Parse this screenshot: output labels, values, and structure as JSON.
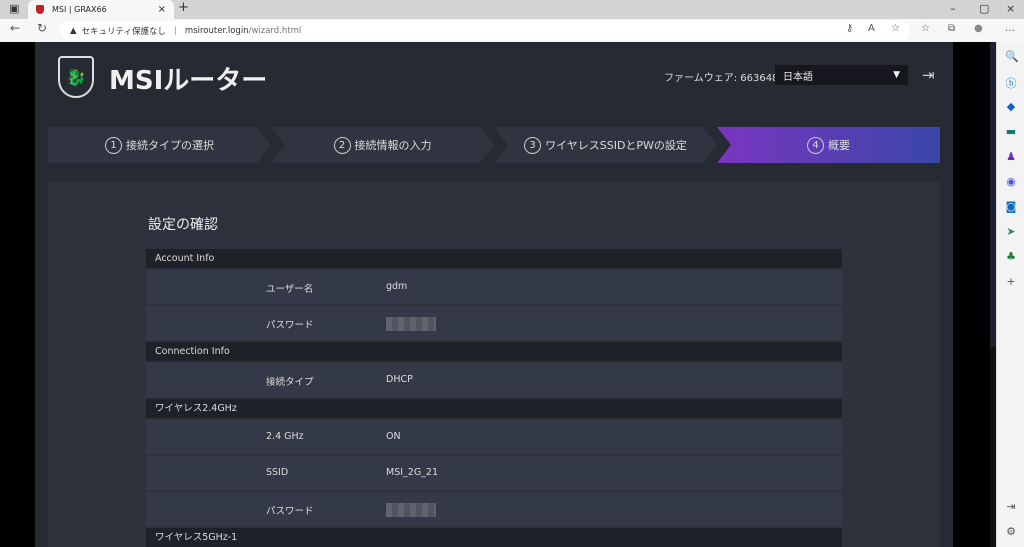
{
  "browser": {
    "tab_title": "MSI | GRAX66",
    "security_label": "セキュリティ保護なし",
    "url_host": "msirouter.login",
    "url_path": "/wizard.html"
  },
  "header": {
    "brand": "MSIルーター",
    "firmware_label": "ファームウェア: 663648",
    "language": "日本語"
  },
  "steps": [
    {
      "num": "1",
      "label": "接続タイプの選択"
    },
    {
      "num": "2",
      "label": "接続情報の入力"
    },
    {
      "num": "3",
      "label": "ワイヤレスSSIDとPWの設定"
    },
    {
      "num": "4",
      "label": "概要",
      "active": true
    }
  ],
  "summary": {
    "title": "設定の確認",
    "account": {
      "header": "Account Info",
      "user_label": "ユーザー名",
      "user_value": "gdm",
      "password_label": "パスワード"
    },
    "connection": {
      "header": "Connection Info",
      "type_label": "接続タイプ",
      "type_value": "DHCP"
    },
    "wifi24": {
      "header": "ワイヤレス2.4GHz",
      "band_label": "2.4 GHz",
      "band_value": "ON",
      "ssid_label": "SSID",
      "ssid_value": "MSI_2G_21",
      "password_label": "パスワード"
    },
    "wifi5": {
      "header": "ワイヤレス5GHz-1"
    }
  },
  "colors": {
    "accent_start": "#7a35c0",
    "accent_end": "#3a47a8"
  }
}
